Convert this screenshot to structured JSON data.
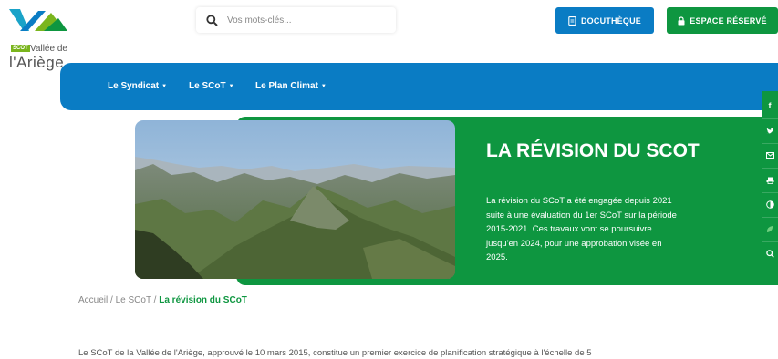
{
  "logo": {
    "badge": "SCOT",
    "line1": "Vallée de",
    "line2": "l'Ariège"
  },
  "search": {
    "placeholder": "Vos mots-clés..."
  },
  "buttons": {
    "docutheque": "DOCUTHÈQUE",
    "espace_reserve": "ESPACE RÉSERVÉ"
  },
  "nav": {
    "items": [
      {
        "label": "Le Syndicat"
      },
      {
        "label": "Le SCoT"
      },
      {
        "label": "Le Plan Climat"
      }
    ]
  },
  "hero": {
    "title": "LA RÉVISION DU SCOT",
    "text": "La révision du SCoT a été engagée depuis 2021 suite à une évaluation du 1er SCoT sur la période 2015-2021. Ces travaux vont se poursuivre jusqu'en 2024, pour une approbation visée en 2025."
  },
  "share": {
    "icons": [
      "facebook-icon",
      "twitter-icon",
      "mail-icon",
      "print-icon",
      "contrast-icon",
      "leaf-icon",
      "search-icon"
    ]
  },
  "breadcrumb": {
    "home": "Accueil",
    "sep": "/",
    "scot": "Le SCoT",
    "current": "La révision du SCoT"
  },
  "body": {
    "intro": "Le SCoT de la Vallée de l'Ariège, approuvé le 10 mars 2015, constitue un premier exercice de planification stratégique à l'échelle de 5"
  },
  "colors": {
    "blue": "#0a7cc4",
    "green": "#0e9640",
    "logo_lime": "#7ab51d"
  }
}
